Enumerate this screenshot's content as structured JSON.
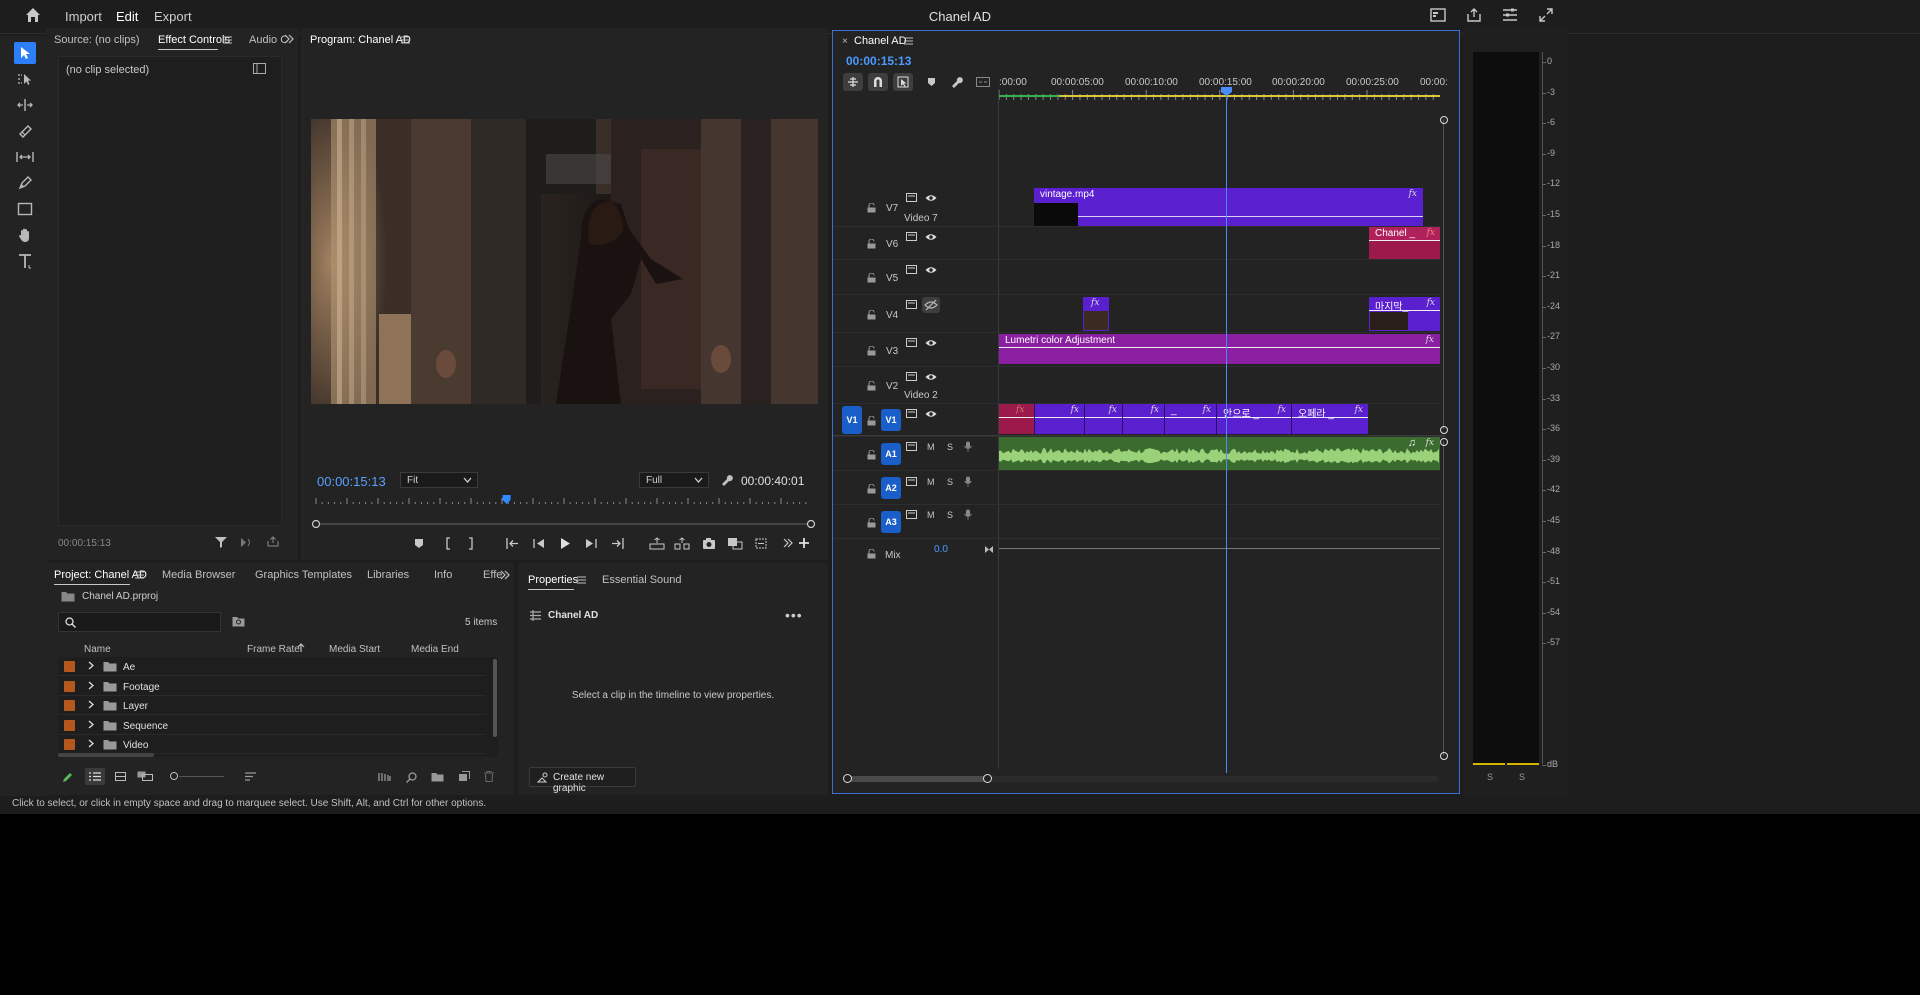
{
  "topbar": {
    "title": "Chanel AD",
    "nav": [
      "Import",
      "Edit",
      "Export"
    ],
    "active_nav": "Edit"
  },
  "source_panel": {
    "tabs": [
      "Source: (no clips)",
      "Effect Controls",
      "Audio C"
    ],
    "active_tab": "Effect Controls",
    "no_clip_label": "(no clip selected)",
    "timecode": "00:00:15:13"
  },
  "program_panel": {
    "title": "Program: Chanel AD",
    "timecode": "00:00:15:13",
    "fit_value": "Fit",
    "quality_value": "Full",
    "duration": "00:00:40:01",
    "playhead_percent": 38.5
  },
  "project_panel": {
    "tabs": [
      "Project: Chanel AD",
      "Media Browser",
      "Graphics Templates",
      "Libraries",
      "Info",
      "Effe"
    ],
    "file_name": "Chanel AD.prproj",
    "search_placeholder": "",
    "item_count": "5 items",
    "columns": [
      "Name",
      "Frame Rate",
      "Media Start",
      "Media End"
    ],
    "rows": [
      {
        "name": "Ae",
        "color": "#b5581e"
      },
      {
        "name": "Footage",
        "color": "#b5581e"
      },
      {
        "name": "Layer",
        "color": "#b5581e"
      },
      {
        "name": "Sequence",
        "color": "#b5581e"
      },
      {
        "name": "Video",
        "color": "#b5581e"
      }
    ]
  },
  "properties_panel": {
    "tabs": [
      "Properties",
      "Essential Sound"
    ],
    "sequence_name": "Chanel AD",
    "hint": "Select a clip in the timeline to view properties.",
    "create_button": "Create new graphic"
  },
  "timeline": {
    "tab_title": "Chanel AD",
    "timecode": "00:00:15:13",
    "ruler": [
      ":00:00",
      "00:00:05:00",
      "00:00:10:00",
      "00:00:15:00",
      "00:00:20:00",
      "00:00:25:00",
      "00:00:"
    ],
    "tracks": [
      {
        "id": "V7",
        "name": "Video 7"
      },
      {
        "id": "V6",
        "name": ""
      },
      {
        "id": "V5",
        "name": ""
      },
      {
        "id": "V4",
        "name": ""
      },
      {
        "id": "V3",
        "name": ""
      },
      {
        "id": "V2",
        "name": "Video 2"
      },
      {
        "id": "V1",
        "name": ""
      },
      {
        "id": "A1",
        "name": ""
      },
      {
        "id": "A2",
        "name": ""
      },
      {
        "id": "A3",
        "name": ""
      }
    ],
    "source_patch": "V1",
    "audio_letters": {
      "m": "M",
      "s": "S"
    },
    "mix_label": "Mix",
    "mix_value": "0.0",
    "clips": {
      "v7": "vintage.mp4",
      "v6": "Chanel _",
      "v4": "마지막_",
      "v3": "Lumetri color Adjustment",
      "v1_a": "_",
      "v1_b": "안으로 _",
      "v1_c": "오페라 _"
    },
    "fx": "fx",
    "music_icon": "♫"
  },
  "meters": {
    "scale": [
      "0",
      "-3",
      "-6",
      "-9",
      "-12",
      "-15",
      "-18",
      "-21",
      "-24",
      "-27",
      "-30",
      "-33",
      "-36",
      "-39",
      "-42",
      "-45",
      "-48",
      "-51",
      "-54",
      "-57",
      "dB"
    ],
    "solo": [
      "S",
      "S"
    ]
  },
  "status_bar": "Click to select, or click in empty space and drag to marquee select. Use Shift, Alt, and Ctrl for other options."
}
